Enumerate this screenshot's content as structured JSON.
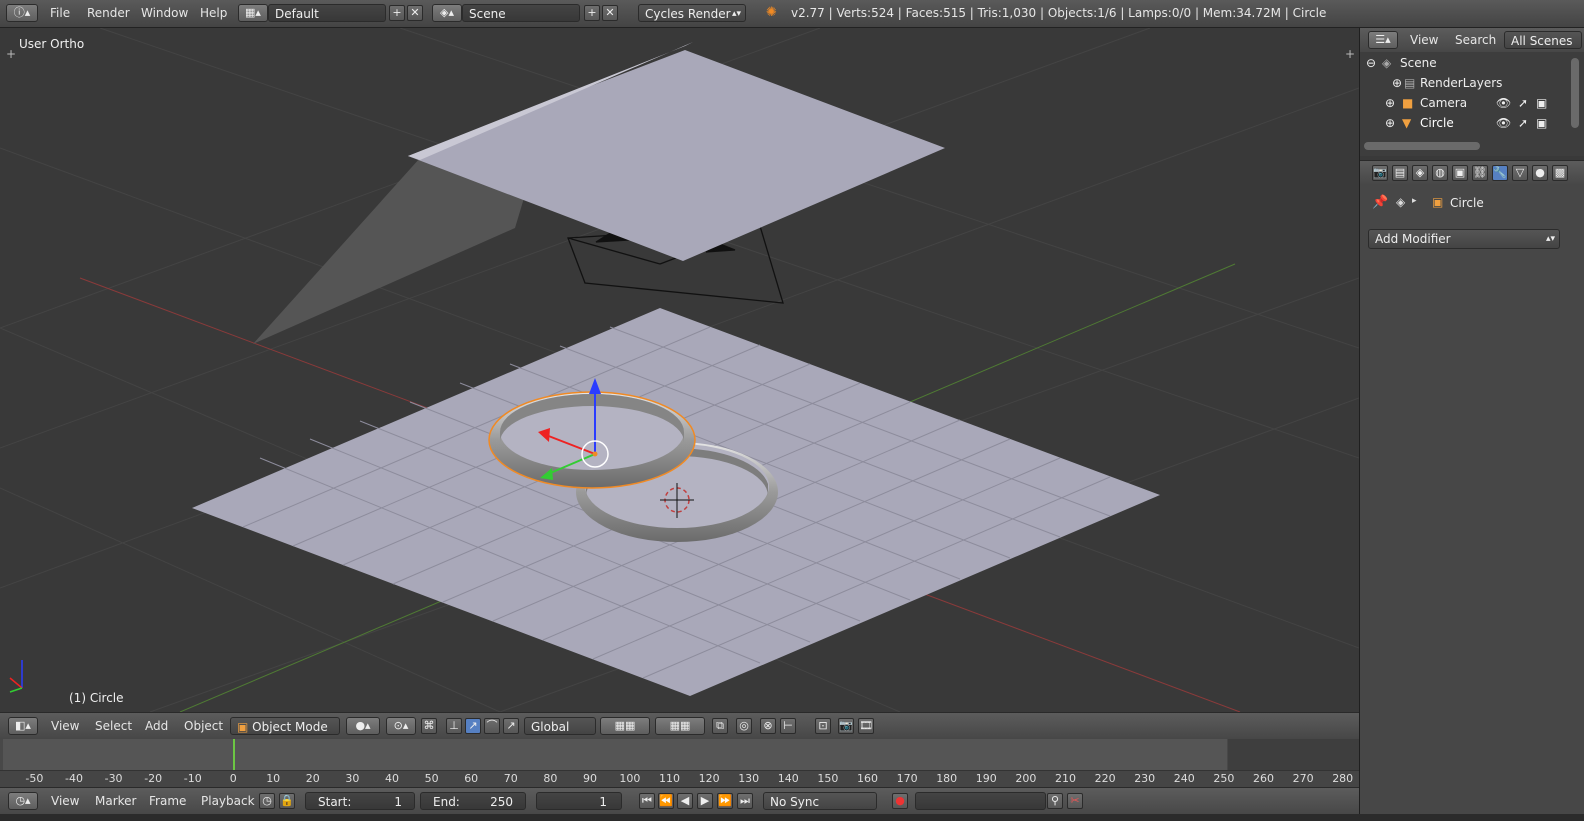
{
  "topbar": {
    "menus": [
      "File",
      "Render",
      "Window",
      "Help"
    ],
    "layout_name": "Default",
    "scene_name": "Scene",
    "engine": "Cycles Render",
    "stats": "v2.77 | Verts:524 | Faces:515 | Tris:1,030 | Objects:1/6 | Lamps:0/0 | Mem:34.72M | Circle"
  },
  "viewport": {
    "view_label": "User Ortho",
    "object_label": "(1) Circle"
  },
  "view_header": {
    "menus": [
      "View",
      "Select",
      "Add",
      "Object"
    ],
    "mode": "Object Mode",
    "orientation": "Global"
  },
  "timeline": {
    "ruler_ticks": [
      "-50",
      "-40",
      "-30",
      "-20",
      "-10",
      "0",
      "10",
      "20",
      "30",
      "40",
      "50",
      "60",
      "70",
      "80",
      "90",
      "100",
      "110",
      "120",
      "130",
      "140",
      "150",
      "160",
      "170",
      "180",
      "190",
      "200",
      "210",
      "220",
      "230",
      "240",
      "250",
      "260",
      "270",
      "280"
    ],
    "menus": [
      "View",
      "Marker",
      "Frame",
      "Playback"
    ],
    "start_label": "Start:",
    "start_value": "1",
    "end_label": "End:",
    "end_value": "250",
    "current_frame": "1",
    "sync": "No Sync"
  },
  "outliner": {
    "header": [
      "View",
      "Search",
      "All Scenes"
    ],
    "items": [
      {
        "label": "Scene"
      },
      {
        "label": "RenderLayers"
      },
      {
        "label": "Camera"
      },
      {
        "label": "Circle"
      }
    ]
  },
  "properties": {
    "object_name": "Circle",
    "add_modifier": "Add Modifier"
  },
  "colors": {
    "accent_blue": "#5680c2",
    "selection_orange": "#f08a24",
    "x_axis": "#c83c3c",
    "y_axis": "#6fae3c"
  }
}
